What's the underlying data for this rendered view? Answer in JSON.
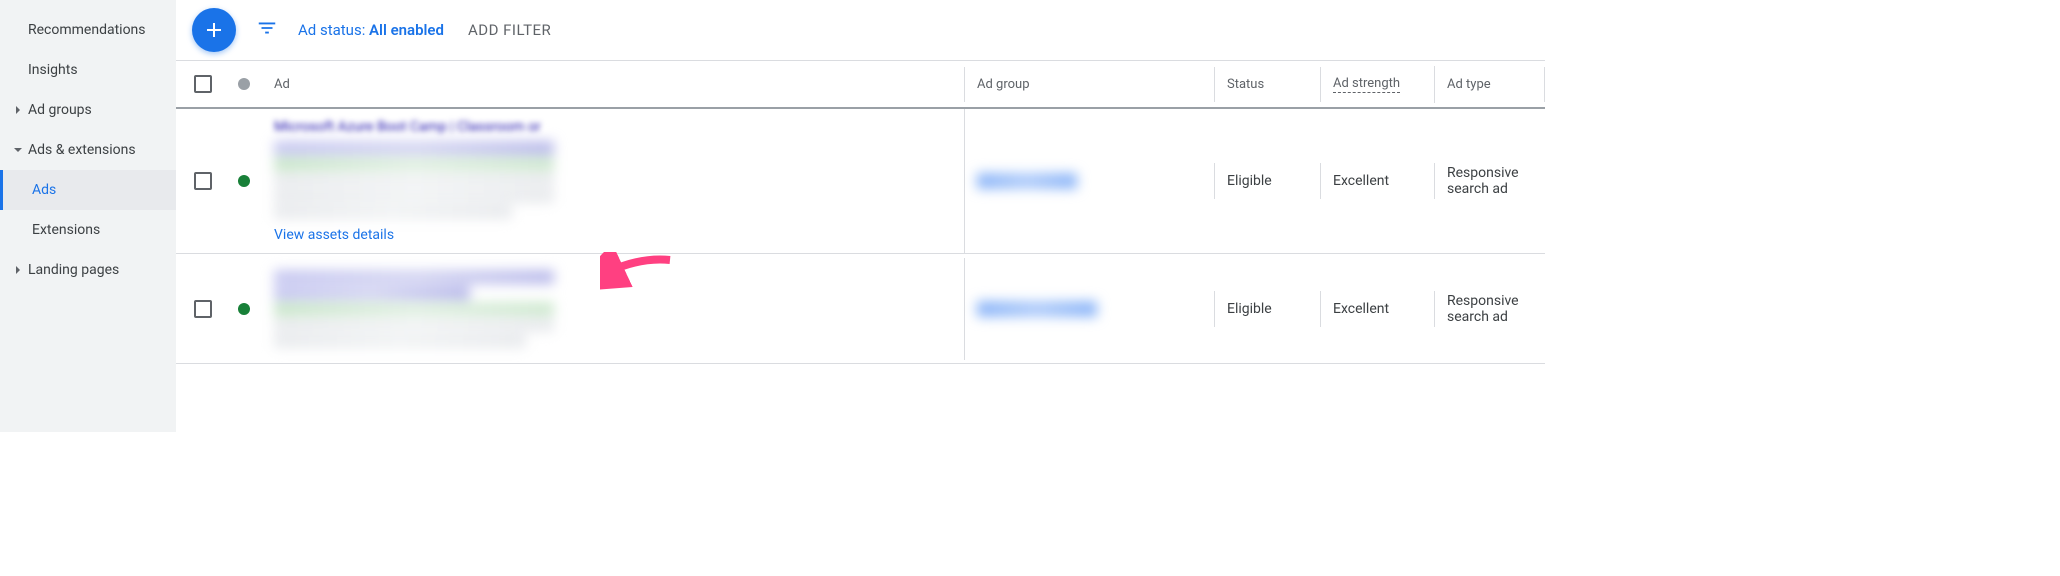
{
  "sidebar": {
    "items": [
      {
        "label": "Recommendations",
        "hasChevron": false
      },
      {
        "label": "Insights",
        "hasChevron": false
      },
      {
        "label": "Ad groups",
        "hasChevron": true,
        "expanded": false
      },
      {
        "label": "Ads & extensions",
        "hasChevron": true,
        "expanded": true,
        "children": [
          {
            "label": "Ads",
            "active": true
          },
          {
            "label": "Extensions",
            "active": false
          }
        ]
      },
      {
        "label": "Landing pages",
        "hasChevron": true,
        "expanded": false
      }
    ]
  },
  "toolbar": {
    "filter_label": "Ad status: ",
    "filter_value": "All enabled",
    "add_filter": "ADD FILTER"
  },
  "table": {
    "headers": {
      "ad": "Ad",
      "adgroup": "Ad group",
      "status": "Status",
      "strength": "Ad strength",
      "type": "Ad type"
    },
    "rows": [
      {
        "ad_title": "Microsoft Azure Boot Camp | Classroom or",
        "view_assets": "View assets details",
        "status": "Eligible",
        "strength": "Excellent",
        "type": "Responsive search ad"
      },
      {
        "status": "Eligible",
        "strength": "Excellent",
        "type": "Responsive search ad"
      }
    ]
  }
}
